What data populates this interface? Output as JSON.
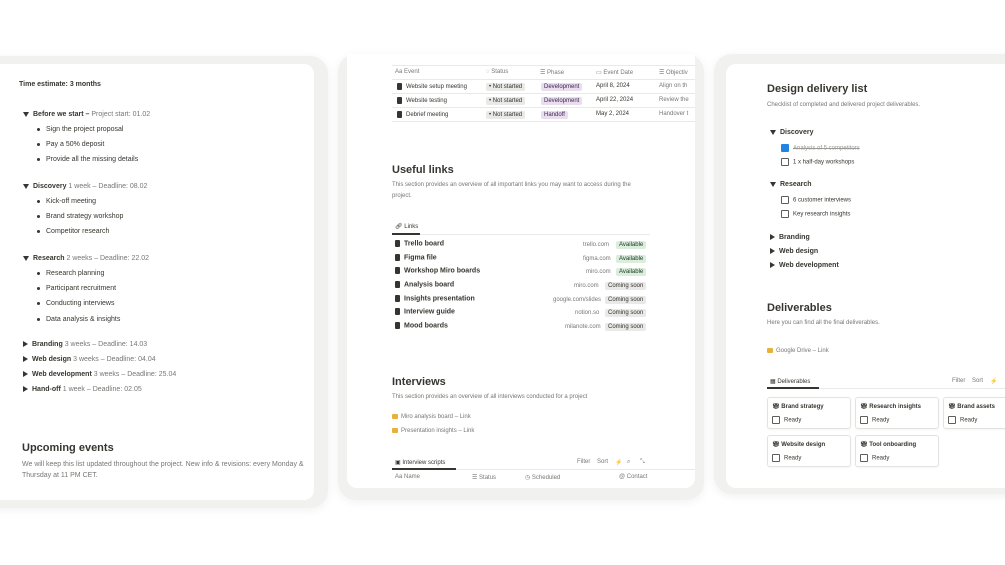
{
  "left": {
    "time_estimate": "Time estimate: 3 months",
    "phases": [
      {
        "title": "Before we start –",
        "meta": "Project start: 01.02",
        "items": [
          "Sign the project proposal",
          "Pay a 50% deposit",
          "Provide all the missing details"
        ]
      },
      {
        "title": "Discovery",
        "meta": "1 week – Deadline: 08.02",
        "items": [
          "Kick-off meeting",
          "Brand strategy workshop",
          "Competitor research"
        ]
      },
      {
        "title": "Research",
        "meta": "2 weeks – Deadline: 22.02",
        "items": [
          "Research planning",
          "Participant recruitment",
          "Conducting interviews",
          "Data analysis & insights"
        ]
      }
    ],
    "collapsed": [
      {
        "title": "Branding",
        "meta": "3 weeks – Deadline: 14.03"
      },
      {
        "title": "Web design",
        "meta": "3 weeks – Deadline: 04.04"
      },
      {
        "title": "Web development",
        "meta": "3 weeks – Deadline: 25.04"
      },
      {
        "title": "Hand-off",
        "meta": "1 week – Deadline: 02.05"
      }
    ],
    "upcoming_title": "Upcoming events",
    "upcoming_desc_1": "We will keep this list updated throughout the project. New info & revisions: every Monday &",
    "upcoming_desc_2": "Thursday at 11 PM CET."
  },
  "middle": {
    "table_headers": [
      "Event",
      "Status",
      "Phase",
      "Event Date",
      "Objectiv"
    ],
    "table_rows": [
      {
        "event": "Website setup meeting",
        "status": "Not started",
        "phase": "Development",
        "date": "April 8, 2024",
        "obj": "Align on th"
      },
      {
        "event": "Website testing",
        "status": "Not started",
        "phase": "Development",
        "date": "April 22, 2024",
        "obj": "Review the"
      },
      {
        "event": "Debrief meeting",
        "status": "Not started",
        "phase": "Handoff",
        "date": "May 2, 2024",
        "obj": "Handover t"
      }
    ],
    "links_title": "Useful links",
    "links_desc_1": "This section provides an overview of all important links you may want to access during the",
    "links_desc_2": "project.",
    "links_tab": "Links",
    "links": [
      {
        "name": "Trello board",
        "domain": "trello.com",
        "status": "Available"
      },
      {
        "name": "Figma file",
        "domain": "figma.com",
        "status": "Available"
      },
      {
        "name": "Workshop Miro boards",
        "domain": "miro.com",
        "status": "Available"
      },
      {
        "name": "Analysis board",
        "domain": "miro.com",
        "status": "Coming soon"
      },
      {
        "name": "Insights presentation",
        "domain": "google.com/slides",
        "status": "Coming soon"
      },
      {
        "name": "Interview guide",
        "domain": "notion.so",
        "status": "Coming soon"
      },
      {
        "name": "Mood boards",
        "domain": "milanote.com",
        "status": "Coming soon"
      }
    ],
    "interviews_title": "Interviews",
    "interviews_desc": "This section provides an overview of all interviews conducted for a project",
    "interview_links": [
      "Miro analysis board – Link",
      "Presentation insights – Link"
    ],
    "scripts_tab": "Interview scripts",
    "toolbar": {
      "filter": "Filter",
      "sort": "Sort"
    },
    "scripts_headers": [
      "Name",
      "Status",
      "Scheduled",
      "Contact"
    ]
  },
  "right": {
    "title": "Design delivery list",
    "desc": "Checklist of completed and delivered project deliverables.",
    "discovery": "Discovery",
    "discovery_items": [
      {
        "label": "Analysis of 5 competitors",
        "checked": true
      },
      {
        "label": "1 x half-day workshops",
        "checked": false
      }
    ],
    "research": "Research",
    "research_items": [
      {
        "label": "6 customer interviews",
        "checked": false
      },
      {
        "label": "Key research insights",
        "checked": false
      }
    ],
    "collapsed": [
      "Branding",
      "Web design",
      "Web development"
    ],
    "deliverables_title": "Deliverables",
    "deliverables_desc": "Here you can find all the final deliverables.",
    "drive_link": "Google Drive – Link",
    "tab": "Deliverables",
    "toolbar": {
      "filter": "Filter",
      "sort": "Sort"
    },
    "cards": [
      {
        "title": "Brand strategy",
        "status": "Ready"
      },
      {
        "title": "Research insights",
        "status": "Ready"
      },
      {
        "title": "Brand assets",
        "status": "Ready"
      },
      {
        "title": "Website design",
        "status": "Ready"
      },
      {
        "title": "Tool onboarding",
        "status": "Ready"
      }
    ]
  }
}
